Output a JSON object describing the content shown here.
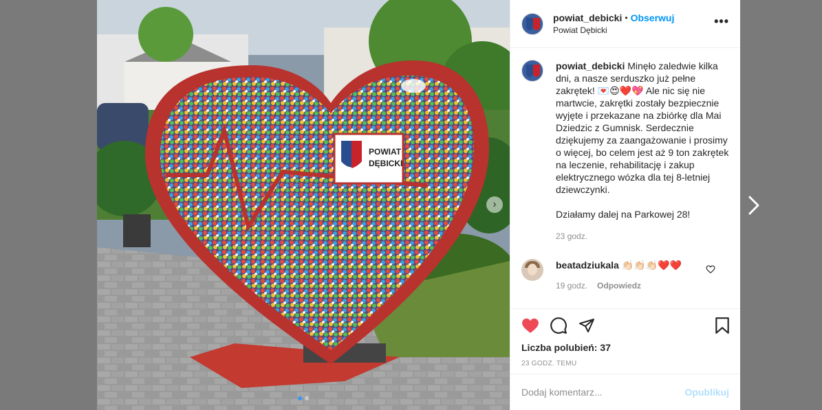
{
  "post": {
    "username": "powiat_debicki",
    "separator": "•",
    "follow_label": "Obserwuj",
    "location": "Powiat Dębicki",
    "more_label": "•••",
    "image_sign_line1": "POWIAT",
    "image_sign_line2": "DĘBICKI"
  },
  "caption": {
    "username": "powiat_debicki",
    "text": "Minęło zaledwie kilka dni, a nasze serduszko już pełne zakrętek! 💌😍❤️💖 Ale nic się nie martwcie, zakrętki zostały bezpiecznie wyjęte i przekazane na zbiórkę dla Mai Dziedzic z Gumnisk. Serdecznie dziękujemy za zaangażowanie i prosimy o więcej, bo celem jest aż 9 ton zakrętek na leczenie, rehabilitację i zakup elektrycznego wózka dla tej 8-letniej dziewczynki.\n\nDziałamy dalej na Parkowej 28!",
    "time": "23 godz."
  },
  "reply": {
    "username": "beatadziukala",
    "text": "👏🏻👏🏻👏🏻❤️❤️",
    "time": "19 godz.",
    "reply_label": "Odpowiedz"
  },
  "actions": {
    "likes": "Liczba polubień: 37",
    "posted": "23 GODZ. TEMU",
    "liked": true
  },
  "composer": {
    "placeholder": "Dodaj komentarz...",
    "publish_label": "Opublikuj"
  },
  "carousel": {
    "slides": 2,
    "active": 0
  },
  "colors": {
    "accent": "#0095f6",
    "like": "#ed4956",
    "heart_frame": "#b8322e"
  }
}
